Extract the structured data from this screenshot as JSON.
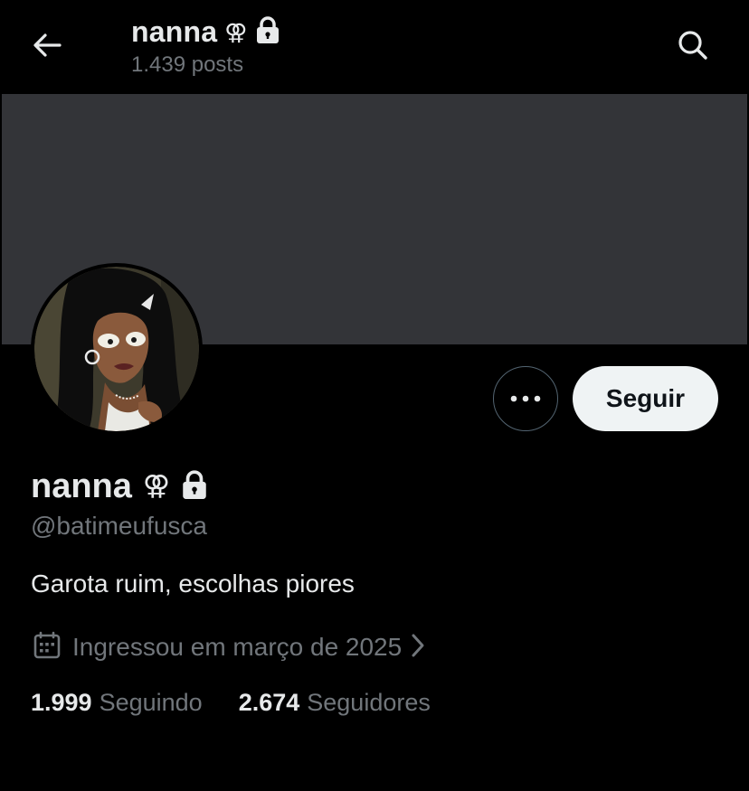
{
  "header": {
    "name": "nanna",
    "emoji": "⚢",
    "posts": "1.439 posts",
    "back_icon": "arrow-left-icon",
    "search_icon": "search-icon"
  },
  "profile": {
    "name": "nanna",
    "emoji": "⚢",
    "handle": "@batimeufusca",
    "bio": "Garota ruim, escolhas piores",
    "joined": "Ingressou em março de 2025",
    "following_count": "1.999",
    "following_label": "Seguindo",
    "followers_count": "2.674",
    "followers_label": "Seguidores",
    "follow_button": "Seguir"
  },
  "colors": {
    "background": "#000000",
    "banner": "#333438",
    "text_primary": "#e7e9ea",
    "text_secondary": "#71767b",
    "follow_button_bg": "#eff3f4"
  }
}
